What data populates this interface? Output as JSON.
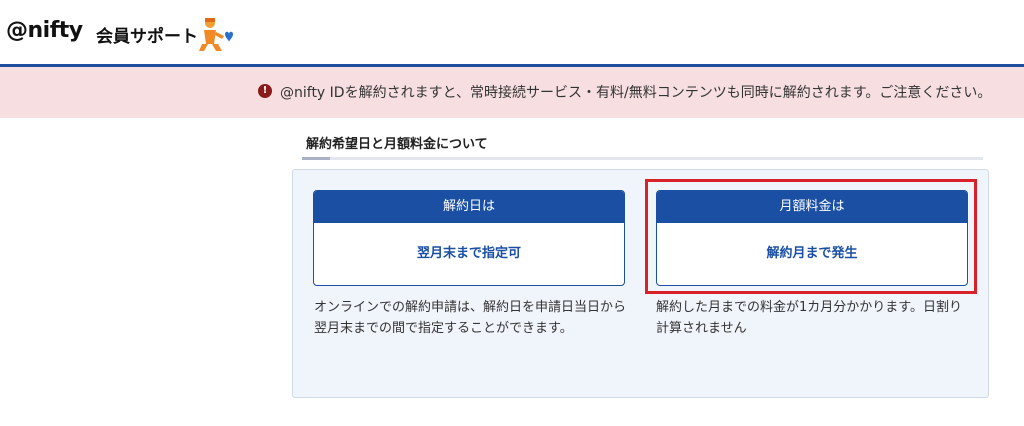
{
  "header": {
    "logo": "@nifty",
    "subtitle": "会員サポート",
    "mascot_icon": "support-mascot-icon"
  },
  "notice": {
    "icon": "exclamation-circle-icon",
    "text": "@nifty IDを解約されますと、常時接続サービス・有料/無料コンテンツも同時に解約されます。ご注意ください。"
  },
  "section": {
    "title": "解約希望日と月額料金について"
  },
  "cards": [
    {
      "header": "解約日は",
      "value": "翌月末まで指定可",
      "description": "オンラインでの解約申請は、解約日を申請日当日から翌月末までの間で指定することができます。"
    },
    {
      "header": "月額料金は",
      "value": "解約月まで発生",
      "description": "解約した月までの料金が1カ月分かかります。日割り計算されません"
    }
  ],
  "colors": {
    "brand_blue": "#1a4fa3",
    "notice_bg": "#f7dfe1",
    "highlight_red": "#d8222a",
    "panel_bg": "#f0f4fb"
  }
}
